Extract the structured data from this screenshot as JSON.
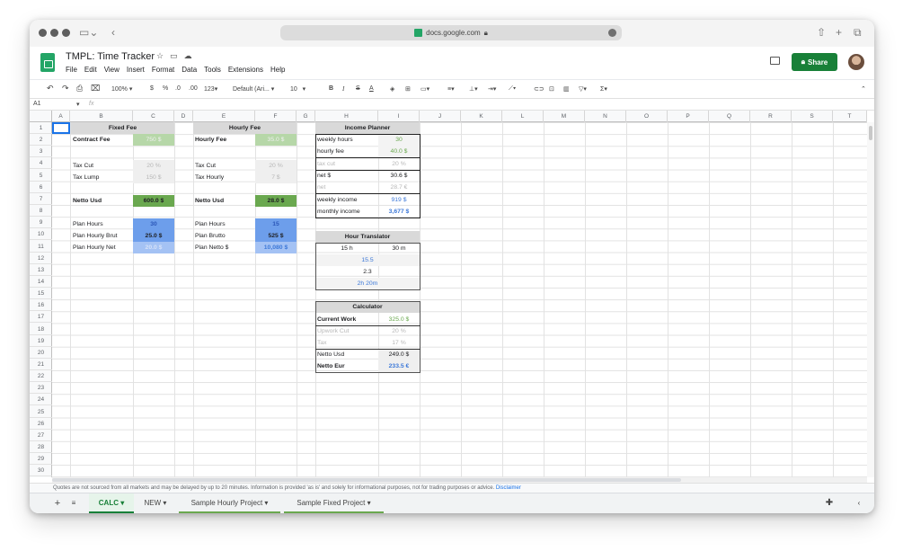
{
  "browser": {
    "url": "docs.google.com"
  },
  "app": {
    "title": "TMPL: Time Tracker",
    "menu": [
      "File",
      "Edit",
      "View",
      "Insert",
      "Format",
      "Data",
      "Tools",
      "Extensions",
      "Help"
    ],
    "share_label": "Share"
  },
  "toolbar": {
    "zoom": "100%",
    "currency": "$",
    "percent": "%",
    "dec_less": ".0",
    "dec_more": ".00",
    "num_format": "123",
    "font": "Default (Ari...",
    "font_size": "10"
  },
  "formula": {
    "cell_ref": "A1",
    "fx": "fx",
    "value": ""
  },
  "columns": [
    "A",
    "B",
    "C",
    "D",
    "E",
    "F",
    "G",
    "H",
    "I",
    "J",
    "K",
    "L",
    "M",
    "N",
    "O",
    "P",
    "Q",
    "R",
    "S",
    "T"
  ],
  "rows": [
    "1",
    "2",
    "3",
    "4",
    "5",
    "6",
    "7",
    "8",
    "9",
    "10",
    "11",
    "12",
    "13",
    "14",
    "15",
    "16",
    "17",
    "18",
    "19",
    "20",
    "21",
    "22",
    "23",
    "24",
    "25",
    "26",
    "27",
    "28",
    "29",
    "30"
  ],
  "fixed": {
    "title": "Fixed Fee",
    "contract_label": "Contract Fee",
    "contract_value": "750 $",
    "taxcut_label": "Tax Cut",
    "taxcut_value": "20 %",
    "taxlump_label": "Tax Lump",
    "taxlump_value": "150 $",
    "netto_label": "Netto Usd",
    "netto_value": "600.0 $",
    "planhours_label": "Plan Hours",
    "planhours_value": "30",
    "planbrut_label": "Plan Hourly Brut",
    "planbrut_value": "25.0 $",
    "plannet_label": "Plan Hourly Net",
    "plannet_value": "20.0 $"
  },
  "hourly": {
    "title": "Hourly Fee",
    "fee_label": "Hourly Fee",
    "fee_value": "35.0 $",
    "taxcut_label": "Tax Cut",
    "taxcut_value": "20 %",
    "taxhourly_label": "Tax Hourly",
    "taxhourly_value": "7 $",
    "netto_label": "Netto Usd",
    "netto_value": "28.0 $",
    "planhours_label": "Plan Hours",
    "planhours_value": "15",
    "planbrutto_label": "Plan Brutto",
    "planbrutto_value": "525 $",
    "plannetto_label": "Plan Netto $",
    "plannetto_value": "10,080 $"
  },
  "planner": {
    "title": "Income Planner",
    "weekly_hours_label": "weekly hours",
    "weekly_hours_value": "30",
    "hourly_fee_label": "hourly fee",
    "hourly_fee_value": "40.0 $",
    "taxcut_label": "tax cut",
    "taxcut_value": "20 %",
    "net_usd_label": "net $",
    "net_usd_value": "30.6 $",
    "net_eur_label": "net",
    "net_eur_value": "28.7 €",
    "weekly_income_label": "weekly income",
    "weekly_income_value": "919 $",
    "monthly_income_label": "monthly income",
    "monthly_income_value": "3,677 $"
  },
  "translator": {
    "title": "Hour Translator",
    "hours_in": "15 h",
    "minutes_in": "30 m",
    "decimal_out": "15.5",
    "decimal_in": "2.3",
    "hm_out": "2h  20m"
  },
  "calculator": {
    "title": "Calculator",
    "current_label": "Current Work",
    "current_value": "325.0 $",
    "upwork_label": "Upwork Cut",
    "upwork_value": "20 %",
    "tax_label": "Tax",
    "tax_value": "17 %",
    "netto_usd_label": "Netto Usd",
    "netto_usd_value": "249.0 $",
    "netto_eur_label": "Netto Eur",
    "netto_eur_value": "233.5  €"
  },
  "disclaimer": {
    "text": "Quotes are not sourced from all markets and may be delayed by up to 20 minutes. Information is provided 'as is' and solely for informational purposes, not for trading purposes or advice.",
    "link": "Disclaimer"
  },
  "tabs": [
    "CALC",
    "NEW",
    "Sample Hourly Project",
    "Sample Fixed Project"
  ],
  "colors": {
    "brand": "#188038",
    "light_green": "#b6d7a8",
    "dark_green": "#6aa84f",
    "blue": "#6d9eeb",
    "light_blue": "#a4c2f4",
    "header_gray": "#d9d9d9"
  }
}
